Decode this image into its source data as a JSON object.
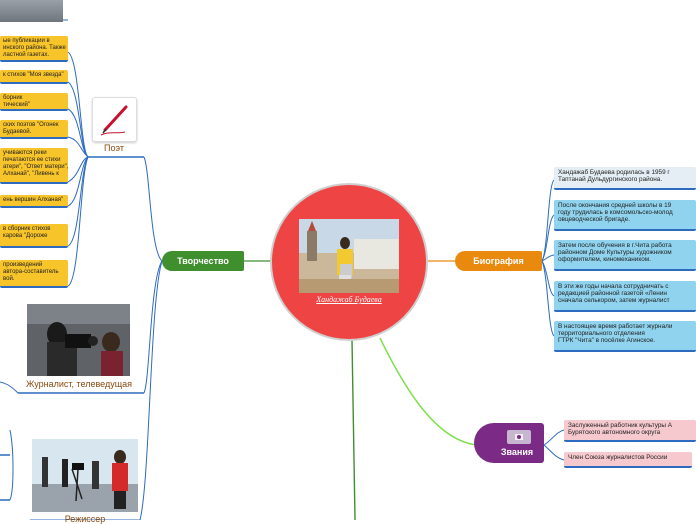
{
  "center": {
    "title": "Хандажаб Будаева"
  },
  "branches": {
    "creativity": "Творчество",
    "biography": "Биография",
    "titles": "Звания"
  },
  "creativity_nodes": {
    "poet": "Поэт",
    "journalist": "Журналист, телеведущая",
    "director": "Режиссер"
  },
  "poet_leaves": [
    "ые публикации в\nинского района. Также\nластной газетах.",
    "к стихов \"Моя звезда\"",
    "борник\nтический\"",
    "ских поэтов \"Огонек\nБудаевой.",
    "учиваются реки\nпечатаются ее стихи\nатери\", \"Ответ матери\",\nАлханай\", \"Ливень к",
    "ень вершин Алханая\"",
    "в сборник стихов\nкарова \"Дороже",
    "произведений\nавтора-составитель\nвой."
  ],
  "biography_leaves": [
    "Хандажаб Будаева родилась в 1959 г\nТаптанай Дульдургинского района.",
    "После окончания средней школы в 19\nгоду трудилась в комсомольско-молод\nовцеводческой бригаде.",
    "Затем после обучения в г.Чита работа\nрайонном Доме Культуры художником\nоформителем, киномехаником.",
    "В эти же годы начала сотрудничать с\nредакцией районной газетой «Ленин\nсначала селькором, затем журналист",
    "В настоящее время работает журнали\nтерриториального отделения\nГТРК \"Чита\" в посёлке Агинское."
  ],
  "titles_leaves": [
    "Заслуженный работник культуры А\nБурятского автономного округа",
    "Член Союза журналистов России"
  ],
  "colors": {
    "center": "#ef4444",
    "creativity": "#3f8f2e",
    "biography": "#e9890e",
    "titles": "#7b2a86",
    "leaf_yellow": "#f7c42a",
    "leaf_blue": "#8fd3ee",
    "leaf_pink": "#f6c9cf"
  },
  "icons": [
    "pen-icon",
    "camera-icon"
  ]
}
